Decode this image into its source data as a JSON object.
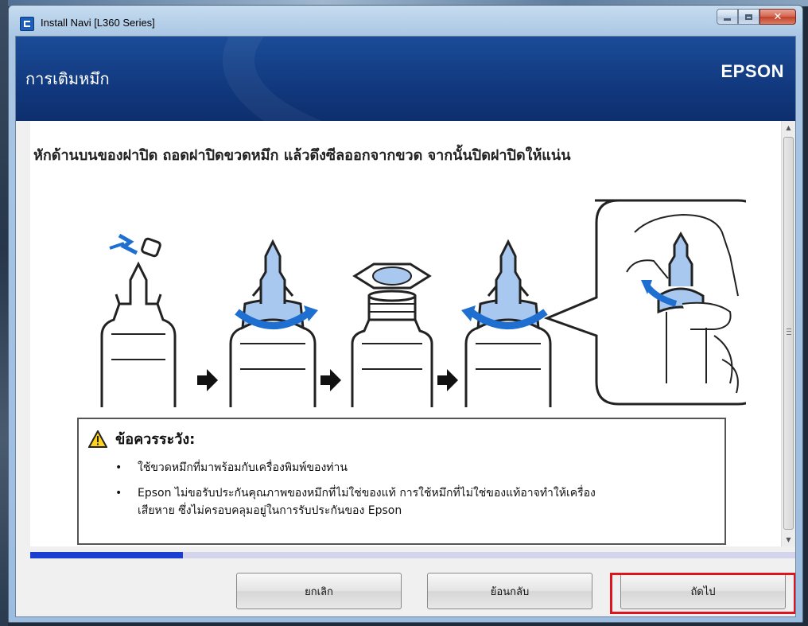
{
  "window": {
    "title": "Install Navi [L360 Series]"
  },
  "header": {
    "page_title": "การเติมหมึก",
    "brand": "EPSON"
  },
  "main": {
    "instruction": "หักด้านบนของฝาปิด ถอดฝาปิดขวดหมึก แล้วดึงซีลออกจากขวด จากนั้นปิดฝาปิดให้แน่น",
    "caution": {
      "title": "ข้อควรระวัง:",
      "items": [
        "ใช้ขวดหมึกที่มาพร้อมกับเครื่องพิมพ์ของท่าน",
        "Epson ไม่ขอรับประกันคุณภาพของหมึกที่ไม่ใช่ของแท้ การใช้หมึกที่ไม่ใช่ของแท้อาจทำให้เครื่อง",
        "เสียหาย ซึ่งไม่ครอบคลุมอยู่ในการรับประกันของ Epson"
      ]
    }
  },
  "progress": {
    "fraction": 0.2
  },
  "buttons": {
    "cancel": "ยกเลิก",
    "back": "ย้อนกลับ",
    "next": "ถัดไป"
  },
  "colors": {
    "header": "#123a80",
    "ink_blue": "#a8c8f0",
    "arrow_blue": "#1e6fd0",
    "progress": "#1a3fd0",
    "highlight": "#e0141c"
  },
  "icons": [
    "app-icon",
    "minimize-icon",
    "maximize-icon",
    "close-icon",
    "warning-icon",
    "scroll-up-icon",
    "scroll-down-icon",
    "next-arrow-icon"
  ]
}
